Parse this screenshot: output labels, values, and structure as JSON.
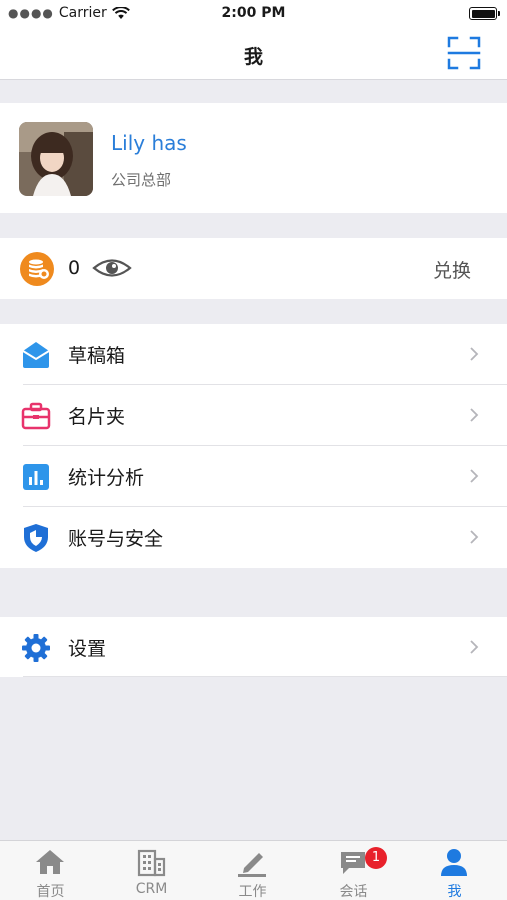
{
  "status_bar": {
    "carrier": "Carrier",
    "time": "2:00 PM"
  },
  "nav": {
    "title": "我",
    "scan_icon": "scan-icon"
  },
  "profile": {
    "name": "Lily has",
    "department": "公司总部"
  },
  "points": {
    "value": "0",
    "exchange_label": "兑换",
    "coin_icon": "coin-stack-icon",
    "eye_icon": "eye-icon"
  },
  "menu": [
    {
      "label": "草稿箱",
      "icon": "envelope-icon",
      "color": "#2e95ea"
    },
    {
      "label": "名片夹",
      "icon": "briefcase-icon",
      "color": "#e8336c"
    },
    {
      "label": "统计分析",
      "icon": "bar-chart-icon",
      "color": "#2e95ea"
    },
    {
      "label": "账号与安全",
      "icon": "shield-icon",
      "color": "#1f6fd6"
    }
  ],
  "menu2": [
    {
      "label": "设置",
      "icon": "gear-icon",
      "color": "#1f6fd6"
    }
  ],
  "tabs": [
    {
      "label": "首页",
      "icon": "home-icon"
    },
    {
      "label": "CRM",
      "icon": "building-icon"
    },
    {
      "label": "工作",
      "icon": "pencil-icon"
    },
    {
      "label": "会话",
      "icon": "chat-icon",
      "badge": "1"
    },
    {
      "label": "我",
      "icon": "person-icon",
      "active": true
    }
  ],
  "colors": {
    "accent": "#1e7ae0",
    "name_blue": "#2a7ed9",
    "badge_red": "#e8212b",
    "coin_orange": "#ef8a1e"
  }
}
